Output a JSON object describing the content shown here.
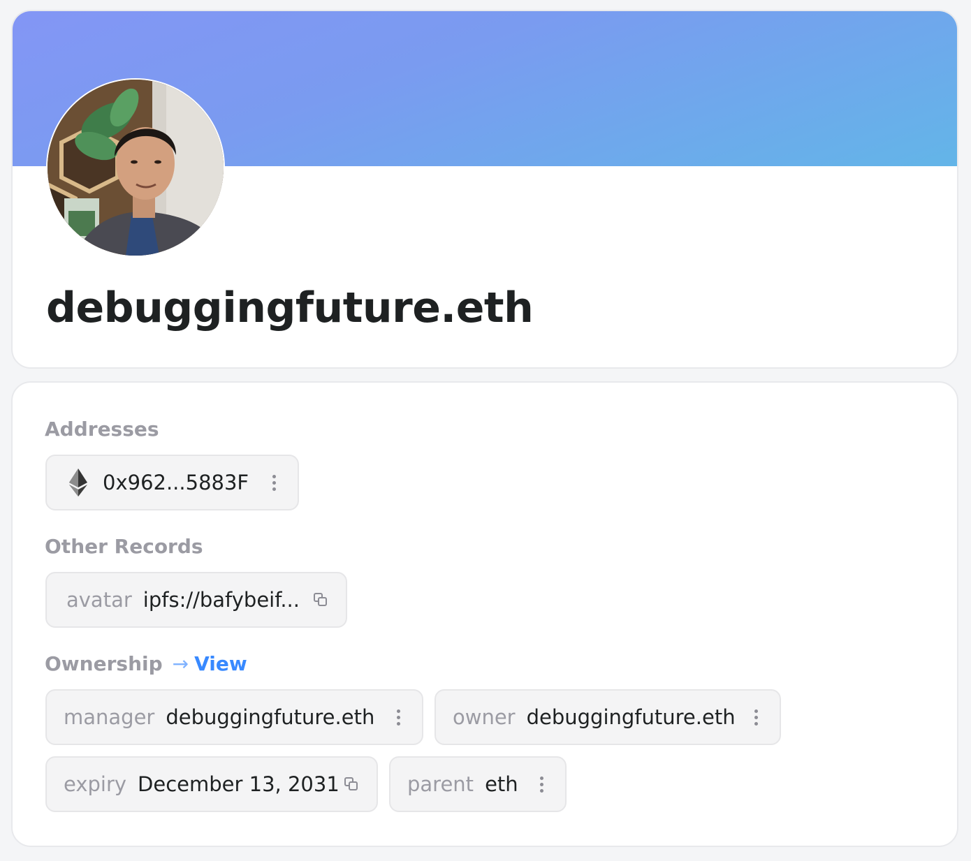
{
  "profile": {
    "name": "debuggingfuture.eth",
    "avatar_alt": "profile avatar photo"
  },
  "addresses": {
    "label": "Addresses",
    "items": [
      {
        "icon": "ethereum-icon",
        "value": "0x962...5883F"
      }
    ]
  },
  "other_records": {
    "label": "Other Records",
    "items": [
      {
        "key": "avatar",
        "value": "ipfs://bafybeif..."
      }
    ]
  },
  "ownership": {
    "label": "Ownership",
    "view_label": "View",
    "manager": {
      "key": "manager",
      "value": "debuggingfuture.eth"
    },
    "owner": {
      "key": "owner",
      "value": "debuggingfuture.eth"
    },
    "expiry": {
      "key": "expiry",
      "value": "December 13, 2031"
    },
    "parent": {
      "key": "parent",
      "value": "eth"
    }
  },
  "colors": {
    "banner_start": "#8396f5",
    "banner_end": "#63b5e8",
    "link": "#3889ff",
    "muted_text": "#9b9ba3"
  }
}
